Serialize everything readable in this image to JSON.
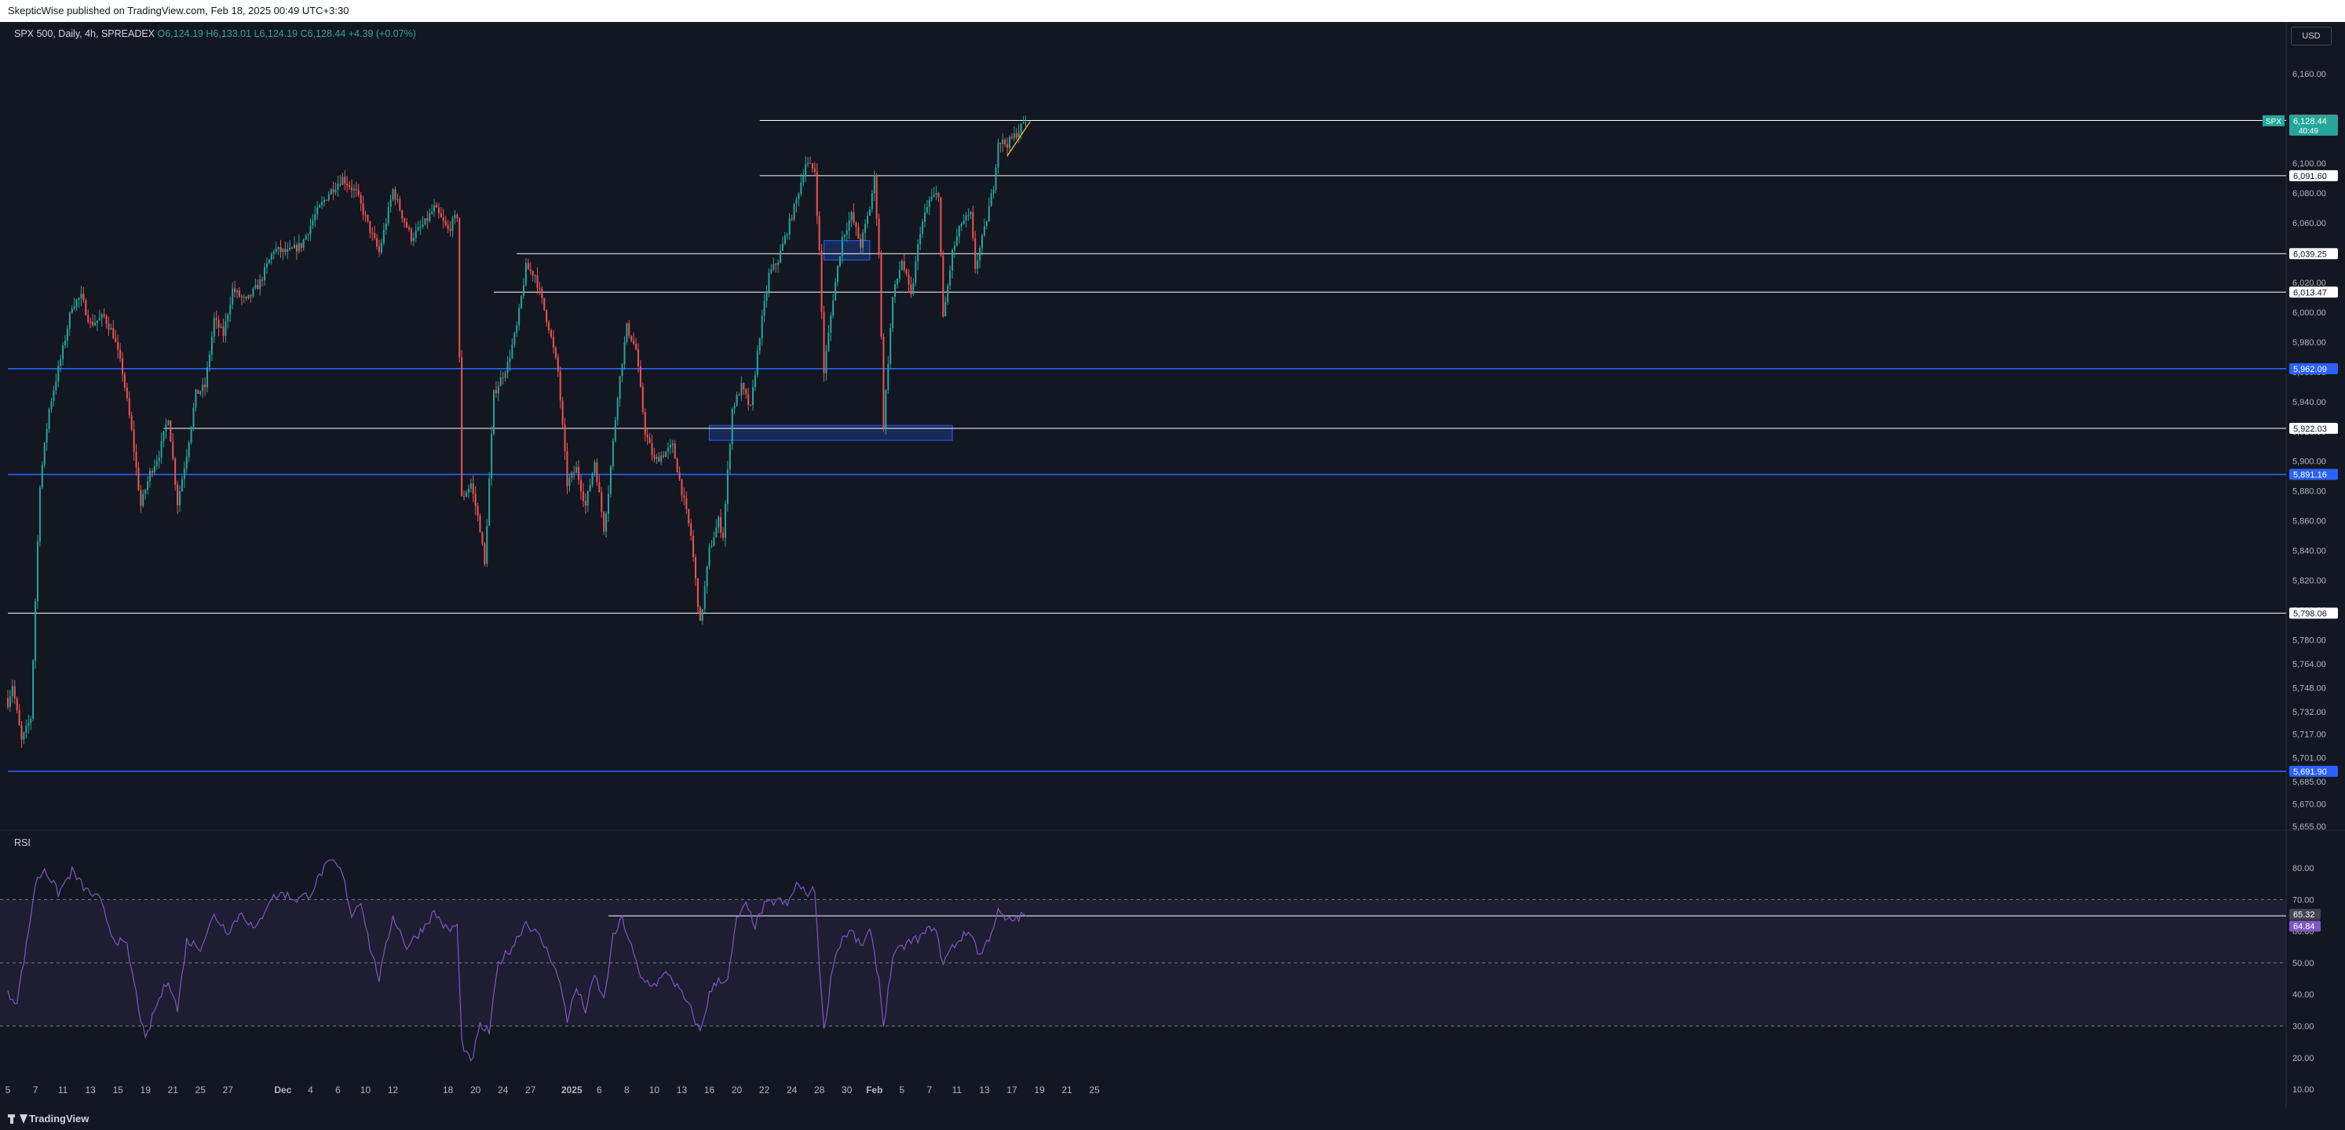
{
  "header": {
    "publisher": "SkepticWise published on TradingView.com, Feb 18, 2025 00:49 UTC+3:30"
  },
  "legend": {
    "symbol": "SPX 500, Daily, 4h, SPREADEX",
    "ohlc": "O6,124.19 H6,133.01 L6,124.19 C6,128.44 +4.39 (+0.07%)"
  },
  "currency": "USD",
  "rsi_label": "RSI",
  "brand": "TradingView",
  "colors": {
    "background": "#131722",
    "up": "#26a69a",
    "down": "#ef5350",
    "blue_line": "#2962ff",
    "rsi": "#7e57c2",
    "trend": "#f7a21b"
  },
  "chart_data": {
    "type": "candlestick",
    "price_axis": {
      "ylim": [
        5655,
        6170
      ],
      "ticks": [
        "6,160.00",
        "6,100.00",
        "6,080.00",
        "6,060.00",
        "6,040.00",
        "6,020.00",
        "6,000.00",
        "5,980.00",
        "5,960.00",
        "5,940.00",
        "5,920.00",
        "5,900.00",
        "5,880.00",
        "5,860.00",
        "5,840.00",
        "5,820.00",
        "5,800.00",
        "5,780.00",
        "5,764.00",
        "5,748.00",
        "5,732.00",
        "5,717.00",
        "5,701.00",
        "5,685.00",
        "5,670.00",
        "5,655.00"
      ]
    },
    "x_axis": {
      "labels": [
        {
          "label": "5",
          "i": 0
        },
        {
          "label": "7",
          "i": 12
        },
        {
          "label": "11",
          "i": 24
        },
        {
          "label": "13",
          "i": 36
        },
        {
          "label": "15",
          "i": 48
        },
        {
          "label": "19",
          "i": 60
        },
        {
          "label": "21",
          "i": 72
        },
        {
          "label": "25",
          "i": 84
        },
        {
          "label": "27",
          "i": 96
        },
        {
          "label": "Dec",
          "i": 120
        },
        {
          "label": "4",
          "i": 132
        },
        {
          "label": "6",
          "i": 144
        },
        {
          "label": "10",
          "i": 156
        },
        {
          "label": "12",
          "i": 168
        },
        {
          "label": "18",
          "i": 192
        },
        {
          "label": "20",
          "i": 204
        },
        {
          "label": "24",
          "i": 216
        },
        {
          "label": "27",
          "i": 228
        },
        {
          "label": "2025",
          "i": 246
        },
        {
          "label": "6",
          "i": 258
        },
        {
          "label": "8",
          "i": 270
        },
        {
          "label": "10",
          "i": 282
        },
        {
          "label": "13",
          "i": 294
        },
        {
          "label": "16",
          "i": 306
        },
        {
          "label": "20",
          "i": 318
        },
        {
          "label": "22",
          "i": 330
        },
        {
          "label": "24",
          "i": 342
        },
        {
          "label": "28",
          "i": 354
        },
        {
          "label": "30",
          "i": 366
        },
        {
          "label": "Feb",
          "i": 378
        },
        {
          "label": "5",
          "i": 390
        },
        {
          "label": "7",
          "i": 402
        },
        {
          "label": "11",
          "i": 414
        },
        {
          "label": "13",
          "i": 426
        },
        {
          "label": "17",
          "i": 438
        },
        {
          "label": "19",
          "i": 450
        },
        {
          "label": "21",
          "i": 462
        },
        {
          "label": "25",
          "i": 474
        }
      ]
    },
    "keypoints": [
      {
        "i": 0,
        "p": 5738
      },
      {
        "i": 2,
        "p": 5750
      },
      {
        "i": 6,
        "p": 5712
      },
      {
        "i": 10,
        "p": 5728
      },
      {
        "i": 14,
        "p": 5885
      },
      {
        "i": 18,
        "p": 5935
      },
      {
        "i": 24,
        "p": 5975
      },
      {
        "i": 28,
        "p": 6005
      },
      {
        "i": 32,
        "p": 6010
      },
      {
        "i": 36,
        "p": 5992
      },
      {
        "i": 42,
        "p": 5997
      },
      {
        "i": 46,
        "p": 5985
      },
      {
        "i": 50,
        "p": 5960
      },
      {
        "i": 54,
        "p": 5920
      },
      {
        "i": 58,
        "p": 5870
      },
      {
        "i": 62,
        "p": 5892
      },
      {
        "i": 66,
        "p": 5905
      },
      {
        "i": 70,
        "p": 5930
      },
      {
        "i": 74,
        "p": 5872
      },
      {
        "i": 78,
        "p": 5905
      },
      {
        "i": 82,
        "p": 5945
      },
      {
        "i": 86,
        "p": 5950
      },
      {
        "i": 90,
        "p": 5995
      },
      {
        "i": 94,
        "p": 5985
      },
      {
        "i": 98,
        "p": 6015
      },
      {
        "i": 104,
        "p": 6007
      },
      {
        "i": 110,
        "p": 6020
      },
      {
        "i": 116,
        "p": 6042
      },
      {
        "i": 122,
        "p": 6040
      },
      {
        "i": 128,
        "p": 6045
      },
      {
        "i": 134,
        "p": 6065
      },
      {
        "i": 140,
        "p": 6080
      },
      {
        "i": 146,
        "p": 6090
      },
      {
        "i": 152,
        "p": 6080
      },
      {
        "i": 158,
        "p": 6055
      },
      {
        "i": 162,
        "p": 6040
      },
      {
        "i": 168,
        "p": 6082
      },
      {
        "i": 172,
        "p": 6065
      },
      {
        "i": 176,
        "p": 6050
      },
      {
        "i": 182,
        "p": 6060
      },
      {
        "i": 186,
        "p": 6070
      },
      {
        "i": 192,
        "p": 6055
      },
      {
        "i": 196,
        "p": 6065
      },
      {
        "i": 198,
        "p": 5875
      },
      {
        "i": 202,
        "p": 5885
      },
      {
        "i": 206,
        "p": 5855
      },
      {
        "i": 208,
        "p": 5830
      },
      {
        "i": 212,
        "p": 5945
      },
      {
        "i": 218,
        "p": 5965
      },
      {
        "i": 222,
        "p": 5990
      },
      {
        "i": 226,
        "p": 6030
      },
      {
        "i": 230,
        "p": 6025
      },
      {
        "i": 236,
        "p": 5990
      },
      {
        "i": 240,
        "p": 5960
      },
      {
        "i": 244,
        "p": 5885
      },
      {
        "i": 248,
        "p": 5895
      },
      {
        "i": 252,
        "p": 5870
      },
      {
        "i": 256,
        "p": 5900
      },
      {
        "i": 260,
        "p": 5855
      },
      {
        "i": 262,
        "p": 5880
      },
      {
        "i": 266,
        "p": 5945
      },
      {
        "i": 270,
        "p": 5990
      },
      {
        "i": 274,
        "p": 5975
      },
      {
        "i": 278,
        "p": 5920
      },
      {
        "i": 282,
        "p": 5900
      },
      {
        "i": 286,
        "p": 5905
      },
      {
        "i": 290,
        "p": 5910
      },
      {
        "i": 294,
        "p": 5880
      },
      {
        "i": 298,
        "p": 5850
      },
      {
        "i": 302,
        "p": 5790
      },
      {
        "i": 306,
        "p": 5840
      },
      {
        "i": 310,
        "p": 5860
      },
      {
        "i": 312,
        "p": 5850
      },
      {
        "i": 316,
        "p": 5935
      },
      {
        "i": 320,
        "p": 5950
      },
      {
        "i": 324,
        "p": 5935
      },
      {
        "i": 328,
        "p": 5985
      },
      {
        "i": 332,
        "p": 6025
      },
      {
        "i": 336,
        "p": 6035
      },
      {
        "i": 340,
        "p": 6055
      },
      {
        "i": 344,
        "p": 6075
      },
      {
        "i": 348,
        "p": 6100
      },
      {
        "i": 352,
        "p": 6095
      },
      {
        "i": 354,
        "p": 6040
      },
      {
        "i": 356,
        "p": 5960
      },
      {
        "i": 360,
        "p": 6010
      },
      {
        "i": 364,
        "p": 6050
      },
      {
        "i": 368,
        "p": 6065
      },
      {
        "i": 372,
        "p": 6045
      },
      {
        "i": 376,
        "p": 6070
      },
      {
        "i": 378,
        "p": 6090
      },
      {
        "i": 380,
        "p": 6040
      },
      {
        "i": 382,
        "p": 5925
      },
      {
        "i": 386,
        "p": 6010
      },
      {
        "i": 390,
        "p": 6035
      },
      {
        "i": 394,
        "p": 6010
      },
      {
        "i": 398,
        "p": 6055
      },
      {
        "i": 402,
        "p": 6075
      },
      {
        "i": 406,
        "p": 6080
      },
      {
        "i": 408,
        "p": 5995
      },
      {
        "i": 412,
        "p": 6040
      },
      {
        "i": 416,
        "p": 6060
      },
      {
        "i": 420,
        "p": 6065
      },
      {
        "i": 422,
        "p": 6030
      },
      {
        "i": 426,
        "p": 6055
      },
      {
        "i": 430,
        "p": 6085
      },
      {
        "i": 432,
        "p": 6115
      },
      {
        "i": 436,
        "p": 6113
      },
      {
        "i": 440,
        "p": 6120
      },
      {
        "i": 444,
        "p": 6128.44
      }
    ],
    "overlays": {
      "horizontal_lines": [
        {
          "price": 6128.69,
          "label": "6,128.69",
          "color": "#ffffff",
          "from_i": 328
        },
        {
          "price": 6091.6,
          "label": "6,091.60",
          "color": "#ffffff",
          "from_i": 328
        },
        {
          "price": 6039.25,
          "label": "6,039.25",
          "color": "#ffffff",
          "from_i": 222
        },
        {
          "price": 6013.47,
          "label": "6,013.47",
          "color": "#ffffff",
          "from_i": 212
        },
        {
          "price": 5962.09,
          "label": "5,962.09",
          "color": "#2962ff",
          "from_i": 0
        },
        {
          "price": 5922.03,
          "label": "5,922.03",
          "color": "#ffffff",
          "from_i": 68
        },
        {
          "price": 5891.16,
          "label": "5,891.16",
          "color": "#2962ff",
          "from_i": 0
        },
        {
          "price": 5798.06,
          "label": "5,798.06",
          "color": "#ffffff",
          "from_i": 0
        },
        {
          "price": 5691.9,
          "label": "5,691.90",
          "color": "#2962ff",
          "from_i": 0
        }
      ],
      "zones": [
        {
          "from_i": 306,
          "to_i": 412,
          "low": 5914,
          "high": 5924
        },
        {
          "from_i": 356,
          "to_i": 376,
          "low": 6035,
          "high": 6048
        }
      ],
      "trendline": {
        "from_i": 436,
        "p1": 6105,
        "to_i": 446,
        "p2": 6128
      },
      "last_price": {
        "symbol": "SPX",
        "price": "6,128.44",
        "countdown": "40:49"
      }
    },
    "rsi": {
      "ylim": [
        12,
        84
      ],
      "ticks": [
        "80.00",
        "70.00",
        "60.00",
        "50.00",
        "40.00",
        "30.00",
        "20.00",
        "10.00"
      ],
      "band": [
        30,
        70
      ],
      "current_labels": [
        "65.32",
        "64.84"
      ],
      "reference_line": {
        "value": 64.84,
        "from_i": 262
      },
      "keypoints": [
        {
          "i": 0,
          "v": 40
        },
        {
          "i": 4,
          "v": 38
        },
        {
          "i": 8,
          "v": 55
        },
        {
          "i": 12,
          "v": 75
        },
        {
          "i": 16,
          "v": 80
        },
        {
          "i": 22,
          "v": 72
        },
        {
          "i": 28,
          "v": 79
        },
        {
          "i": 34,
          "v": 73
        },
        {
          "i": 40,
          "v": 70
        },
        {
          "i": 46,
          "v": 58
        },
        {
          "i": 52,
          "v": 55
        },
        {
          "i": 56,
          "v": 40
        },
        {
          "i": 60,
          "v": 25
        },
        {
          "i": 64,
          "v": 35
        },
        {
          "i": 70,
          "v": 45
        },
        {
          "i": 74,
          "v": 35
        },
        {
          "i": 78,
          "v": 57
        },
        {
          "i": 84,
          "v": 55
        },
        {
          "i": 90,
          "v": 65
        },
        {
          "i": 96,
          "v": 60
        },
        {
          "i": 102,
          "v": 66
        },
        {
          "i": 108,
          "v": 60
        },
        {
          "i": 114,
          "v": 70
        },
        {
          "i": 120,
          "v": 72
        },
        {
          "i": 126,
          "v": 70
        },
        {
          "i": 132,
          "v": 72
        },
        {
          "i": 138,
          "v": 80
        },
        {
          "i": 142,
          "v": 82
        },
        {
          "i": 146,
          "v": 78
        },
        {
          "i": 150,
          "v": 65
        },
        {
          "i": 154,
          "v": 70
        },
        {
          "i": 158,
          "v": 55
        },
        {
          "i": 162,
          "v": 45
        },
        {
          "i": 168,
          "v": 65
        },
        {
          "i": 174,
          "v": 55
        },
        {
          "i": 180,
          "v": 60
        },
        {
          "i": 186,
          "v": 66
        },
        {
          "i": 192,
          "v": 60
        },
        {
          "i": 196,
          "v": 62
        },
        {
          "i": 198,
          "v": 25
        },
        {
          "i": 202,
          "v": 18
        },
        {
          "i": 206,
          "v": 30
        },
        {
          "i": 210,
          "v": 28
        },
        {
          "i": 214,
          "v": 50
        },
        {
          "i": 220,
          "v": 55
        },
        {
          "i": 226,
          "v": 63
        },
        {
          "i": 232,
          "v": 58
        },
        {
          "i": 238,
          "v": 50
        },
        {
          "i": 242,
          "v": 40
        },
        {
          "i": 244,
          "v": 32
        },
        {
          "i": 248,
          "v": 42
        },
        {
          "i": 252,
          "v": 35
        },
        {
          "i": 256,
          "v": 46
        },
        {
          "i": 260,
          "v": 38
        },
        {
          "i": 264,
          "v": 58
        },
        {
          "i": 268,
          "v": 64
        },
        {
          "i": 272,
          "v": 55
        },
        {
          "i": 276,
          "v": 45
        },
        {
          "i": 282,
          "v": 43
        },
        {
          "i": 288,
          "v": 47
        },
        {
          "i": 294,
          "v": 40
        },
        {
          "i": 298,
          "v": 35
        },
        {
          "i": 302,
          "v": 28
        },
        {
          "i": 306,
          "v": 40
        },
        {
          "i": 310,
          "v": 45
        },
        {
          "i": 314,
          "v": 44
        },
        {
          "i": 318,
          "v": 64
        },
        {
          "i": 322,
          "v": 68
        },
        {
          "i": 326,
          "v": 62
        },
        {
          "i": 330,
          "v": 68
        },
        {
          "i": 336,
          "v": 70
        },
        {
          "i": 340,
          "v": 68
        },
        {
          "i": 344,
          "v": 75
        },
        {
          "i": 348,
          "v": 72
        },
        {
          "i": 352,
          "v": 73
        },
        {
          "i": 354,
          "v": 50
        },
        {
          "i": 356,
          "v": 28
        },
        {
          "i": 360,
          "v": 50
        },
        {
          "i": 364,
          "v": 58
        },
        {
          "i": 368,
          "v": 60
        },
        {
          "i": 372,
          "v": 55
        },
        {
          "i": 376,
          "v": 60
        },
        {
          "i": 380,
          "v": 45
        },
        {
          "i": 382,
          "v": 30
        },
        {
          "i": 386,
          "v": 52
        },
        {
          "i": 392,
          "v": 56
        },
        {
          "i": 398,
          "v": 58
        },
        {
          "i": 404,
          "v": 62
        },
        {
          "i": 408,
          "v": 50
        },
        {
          "i": 412,
          "v": 55
        },
        {
          "i": 416,
          "v": 58
        },
        {
          "i": 420,
          "v": 60
        },
        {
          "i": 424,
          "v": 52
        },
        {
          "i": 428,
          "v": 58
        },
        {
          "i": 432,
          "v": 66
        },
        {
          "i": 436,
          "v": 63
        },
        {
          "i": 440,
          "v": 64
        },
        {
          "i": 444,
          "v": 65.32
        }
      ]
    }
  }
}
